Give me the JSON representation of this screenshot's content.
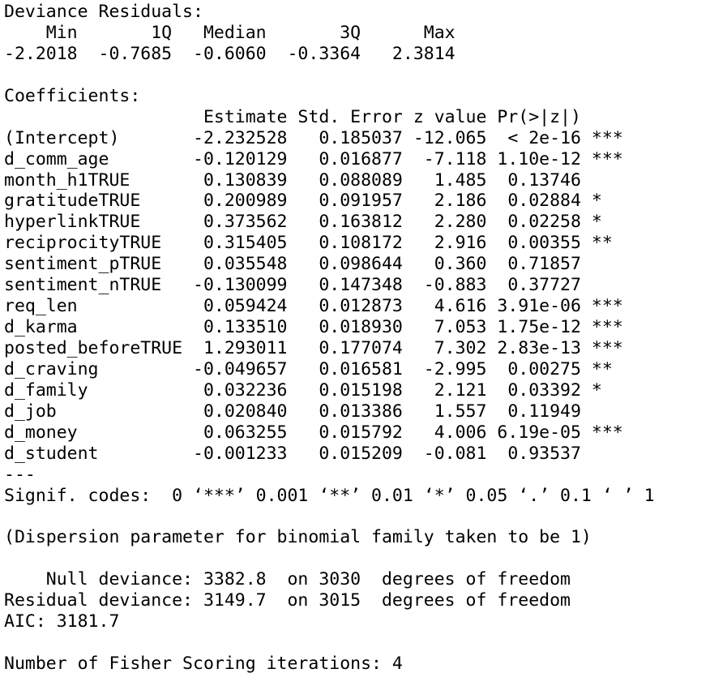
{
  "output_lines": [
    "Deviance Residuals:",
    "    Min       1Q   Median       3Q      Max",
    "-2.2018  -0.7685  -0.6060  -0.3364   2.3814",
    "",
    "Coefficients:",
    "                   Estimate Std. Error z value Pr(>|z|)",
    "(Intercept)       -2.232528   0.185037 -12.065  < 2e-16 ***",
    "d_comm_age        -0.120129   0.016877  -7.118 1.10e-12 ***",
    "month_h1TRUE       0.130839   0.088089   1.485  0.13746",
    "gratitudeTRUE      0.200989   0.091957   2.186  0.02884 *",
    "hyperlinkTRUE      0.373562   0.163812   2.280  0.02258 *",
    "reciprocityTRUE    0.315405   0.108172   2.916  0.00355 **",
    "sentiment_pTRUE    0.035548   0.098644   0.360  0.71857",
    "sentiment_nTRUE   -0.130099   0.147348  -0.883  0.37727",
    "req_len            0.059424   0.012873   4.616 3.91e-06 ***",
    "d_karma            0.133510   0.018930   7.053 1.75e-12 ***",
    "posted_beforeTRUE  1.293011   0.177074   7.302 2.83e-13 ***",
    "d_craving         -0.049657   0.016581  -2.995  0.00275 **",
    "d_family           0.032236   0.015198   2.121  0.03392 *",
    "d_job              0.020840   0.013386   1.557  0.11949",
    "d_money            0.063255   0.015792   4.006 6.19e-05 ***",
    "d_student         -0.001233   0.015209  -0.081  0.93537",
    "---",
    "Signif. codes:  0 ‘***’ 0.001 ‘**’ 0.01 ‘*’ 0.05 ‘.’ 0.1 ‘ ’ 1",
    "",
    "(Dispersion parameter for binomial family taken to be 1)",
    "",
    "    Null deviance: 3382.8  on 3030  degrees of freedom",
    "Residual deviance: 3149.7  on 3015  degrees of freedom",
    "AIC: 3181.7",
    "",
    "Number of Fisher Scoring iterations: 4"
  ]
}
